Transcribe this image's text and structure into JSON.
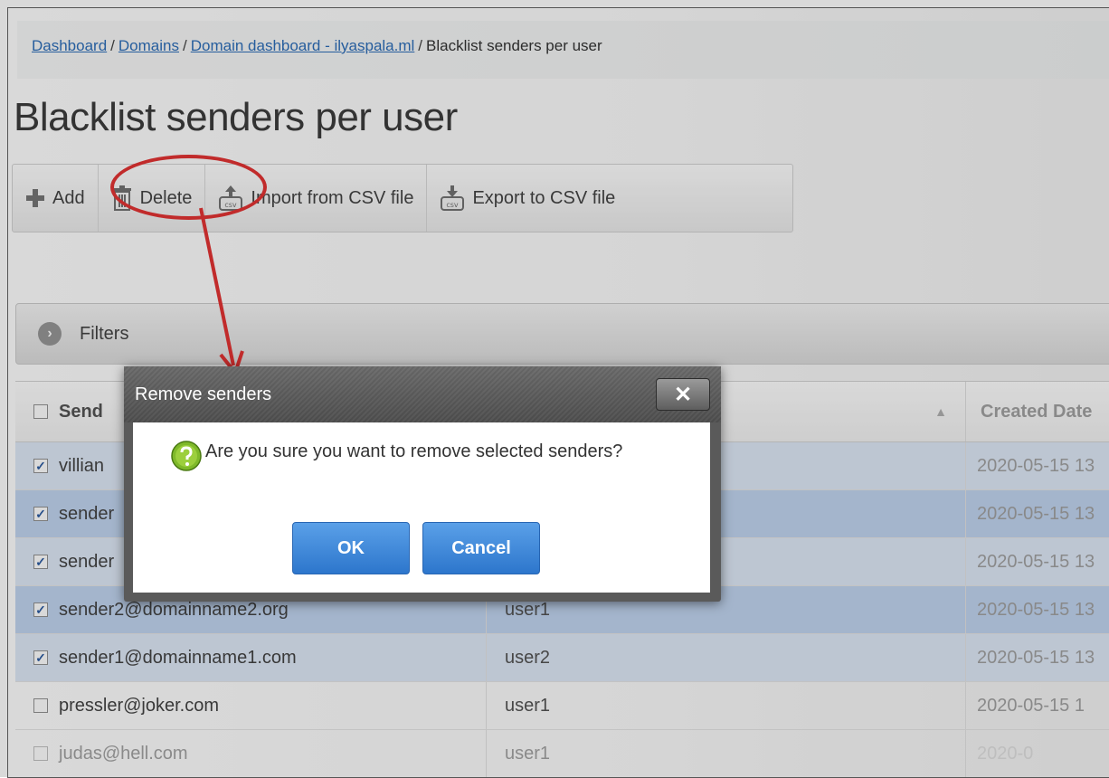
{
  "breadcrumb": {
    "items": [
      "Dashboard",
      "Domains",
      "Domain dashboard - ilyaspala.ml"
    ],
    "separator": "/",
    "current": "Blacklist senders per user"
  },
  "page": {
    "title": "Blacklist senders per user"
  },
  "toolbar": {
    "add": "Add",
    "delete": "Delete",
    "import": "Import from CSV file",
    "export": "Export to CSV file",
    "annotation_color": "#e02020"
  },
  "filters": {
    "label": "Filters"
  },
  "table": {
    "headers": {
      "sender": "Send",
      "created": "Created Date"
    },
    "rows": [
      {
        "sender": "villian",
        "user": "",
        "created": "2020-05-15 13",
        "checked": true
      },
      {
        "sender": "sender",
        "user": "",
        "created": "2020-05-15 13",
        "checked": true
      },
      {
        "sender": "sender",
        "user": "",
        "created": "2020-05-15 13",
        "checked": true
      },
      {
        "sender": "sender2@domainname2.org",
        "user": "user1",
        "created": "2020-05-15 13",
        "checked": true
      },
      {
        "sender": "sender1@domainname1.com",
        "user": "user2",
        "created": "2020-05-15 13",
        "checked": true
      },
      {
        "sender": "pressler@joker.com",
        "user": "user1",
        "created": "2020-05-15 1",
        "checked": false
      },
      {
        "sender": "judas@hell.com",
        "user": "user1",
        "created": "2020-0",
        "checked": false
      }
    ]
  },
  "dialog": {
    "title": "Remove senders",
    "close": "✕",
    "message": "Are you sure you want to remove selected senders?",
    "ok": "OK",
    "cancel": "Cancel"
  }
}
